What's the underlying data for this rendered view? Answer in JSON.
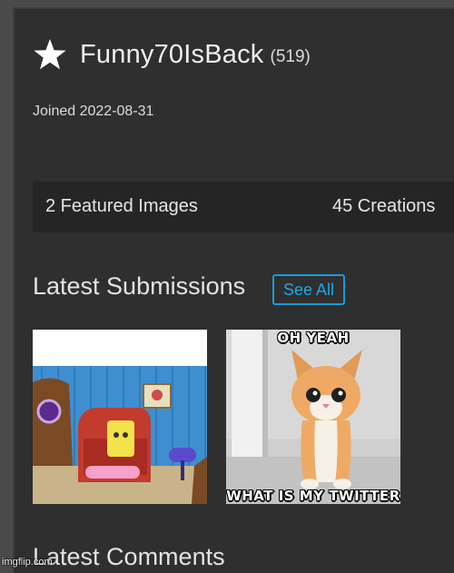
{
  "profile": {
    "username": "Funny70IsBack",
    "points": "(519)",
    "joined": "Joined 2022-08-31"
  },
  "stats": {
    "featured": "2 Featured Images",
    "creations": "45 Creations"
  },
  "submissions": {
    "title": "Latest Submissions",
    "see_all": "See All",
    "items": [
      {
        "top_caption": "",
        "bottom_caption": ""
      },
      {
        "top_caption": "OH YEAH",
        "bottom_caption": "WHAT IS MY TWITTER"
      }
    ]
  },
  "comments": {
    "title": "Latest Comments"
  },
  "watermark": "imgflip.com",
  "colors": {
    "panel": "#2f2f2f",
    "stats_bar": "#252525",
    "accent": "#1c9ad6"
  },
  "icons": {
    "star": "star-icon"
  }
}
